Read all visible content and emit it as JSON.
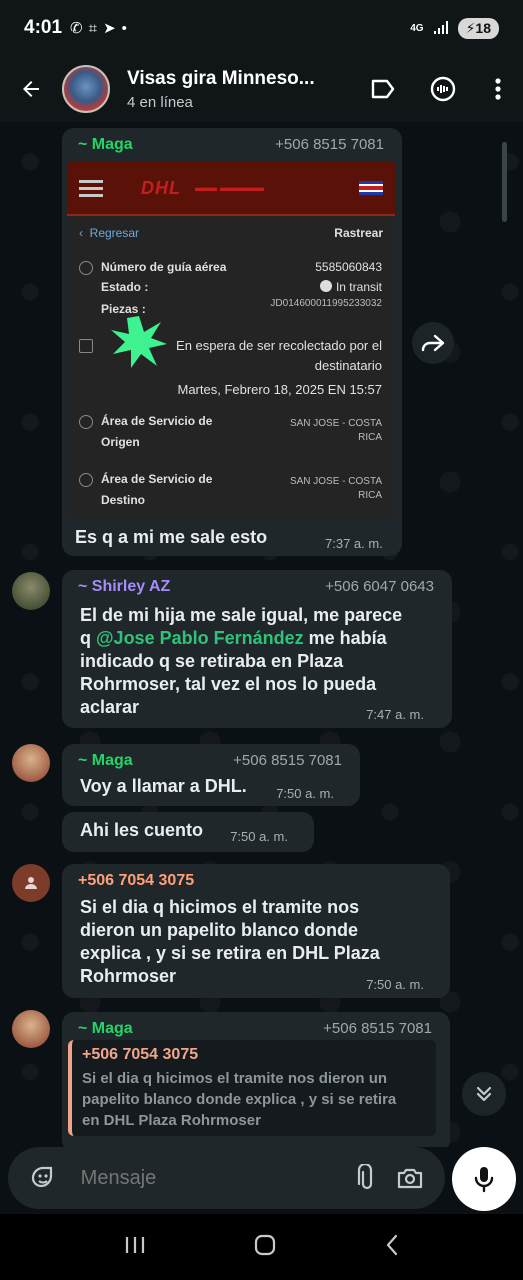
{
  "status_bar": {
    "time": "4:01",
    "battery": "18",
    "network": "4G"
  },
  "header": {
    "title": "Visas gira Minneso...",
    "subtitle": "4 en línea"
  },
  "screenshot": {
    "nav_back": "Regresar",
    "nav_track": "Rastrear",
    "brand": "DHL",
    "tracking_label": "Número de guía aérea",
    "tracking_number": "5585060843",
    "status_label": "Estado :",
    "status_value": "In transit",
    "pieces_label": "Piezas :",
    "pieces_value": "JD014600011995233032",
    "event_text_1": "En espera de ser recolectado por el",
    "event_text_2": "destinatario",
    "event_date": "Martes, Febrero 18, 2025 EN 15:57",
    "origin_label_1": "Área de Servicio de",
    "origin_label_2": "Origen",
    "origin_value_1": "SAN JOSE - COSTA",
    "origin_value_2": "RICA",
    "dest_label_1": "Área de Servicio de",
    "dest_label_2": "Destino",
    "dest_value_1": "SAN JOSE - COSTA",
    "dest_value_2": "RICA"
  },
  "messages": [
    {
      "sender": "~ Maga",
      "phone": "+506 8515 7081",
      "text": "Es q a mi me sale esto",
      "time": "7:37 a. m."
    },
    {
      "sender": "~ Shirley AZ",
      "phone": "+506 6047 0643",
      "text_1": "El de mi hija me sale igual, me parece",
      "text_2a": "q ",
      "mention": "@Jose Pablo Fernández",
      "text_2b": " me había",
      "text_3": "indicado q se retiraba en Plaza",
      "text_4": "Rohrmoser, tal vez el nos lo pueda",
      "text_5": "aclarar",
      "time": "7:47 a. m."
    },
    {
      "sender": "~ Maga",
      "phone": "+506 8515 7081",
      "text": "Voy a llamar a DHL.",
      "time": "7:50 a. m."
    },
    {
      "text": "Ahi les cuento",
      "time": "7:50 a. m."
    },
    {
      "sender": "+506 7054 3075",
      "text_1": "Si el dia q hicimos el tramite nos",
      "text_2": "dieron un papelito blanco donde",
      "text_3": "explica , y si se retira en DHL Plaza",
      "text_4": "Rohrmoser",
      "time": "7:50 a. m."
    },
    {
      "sender": "~ Maga",
      "phone": "+506 8515 7081",
      "quote_sender": "+506 7054 3075",
      "quote_1": "Si el dia q hicimos el tramite nos dieron un",
      "quote_2": "papelito blanco donde explica , y si se retira",
      "quote_3": "en DHL Plaza Rohrmoser"
    }
  ],
  "input": {
    "placeholder": "Mensaje"
  },
  "colors": {
    "maga": "#25d366",
    "shirley": "#a78bfa",
    "unknown": "#ff9f7a",
    "bubble": "#1f272a"
  }
}
